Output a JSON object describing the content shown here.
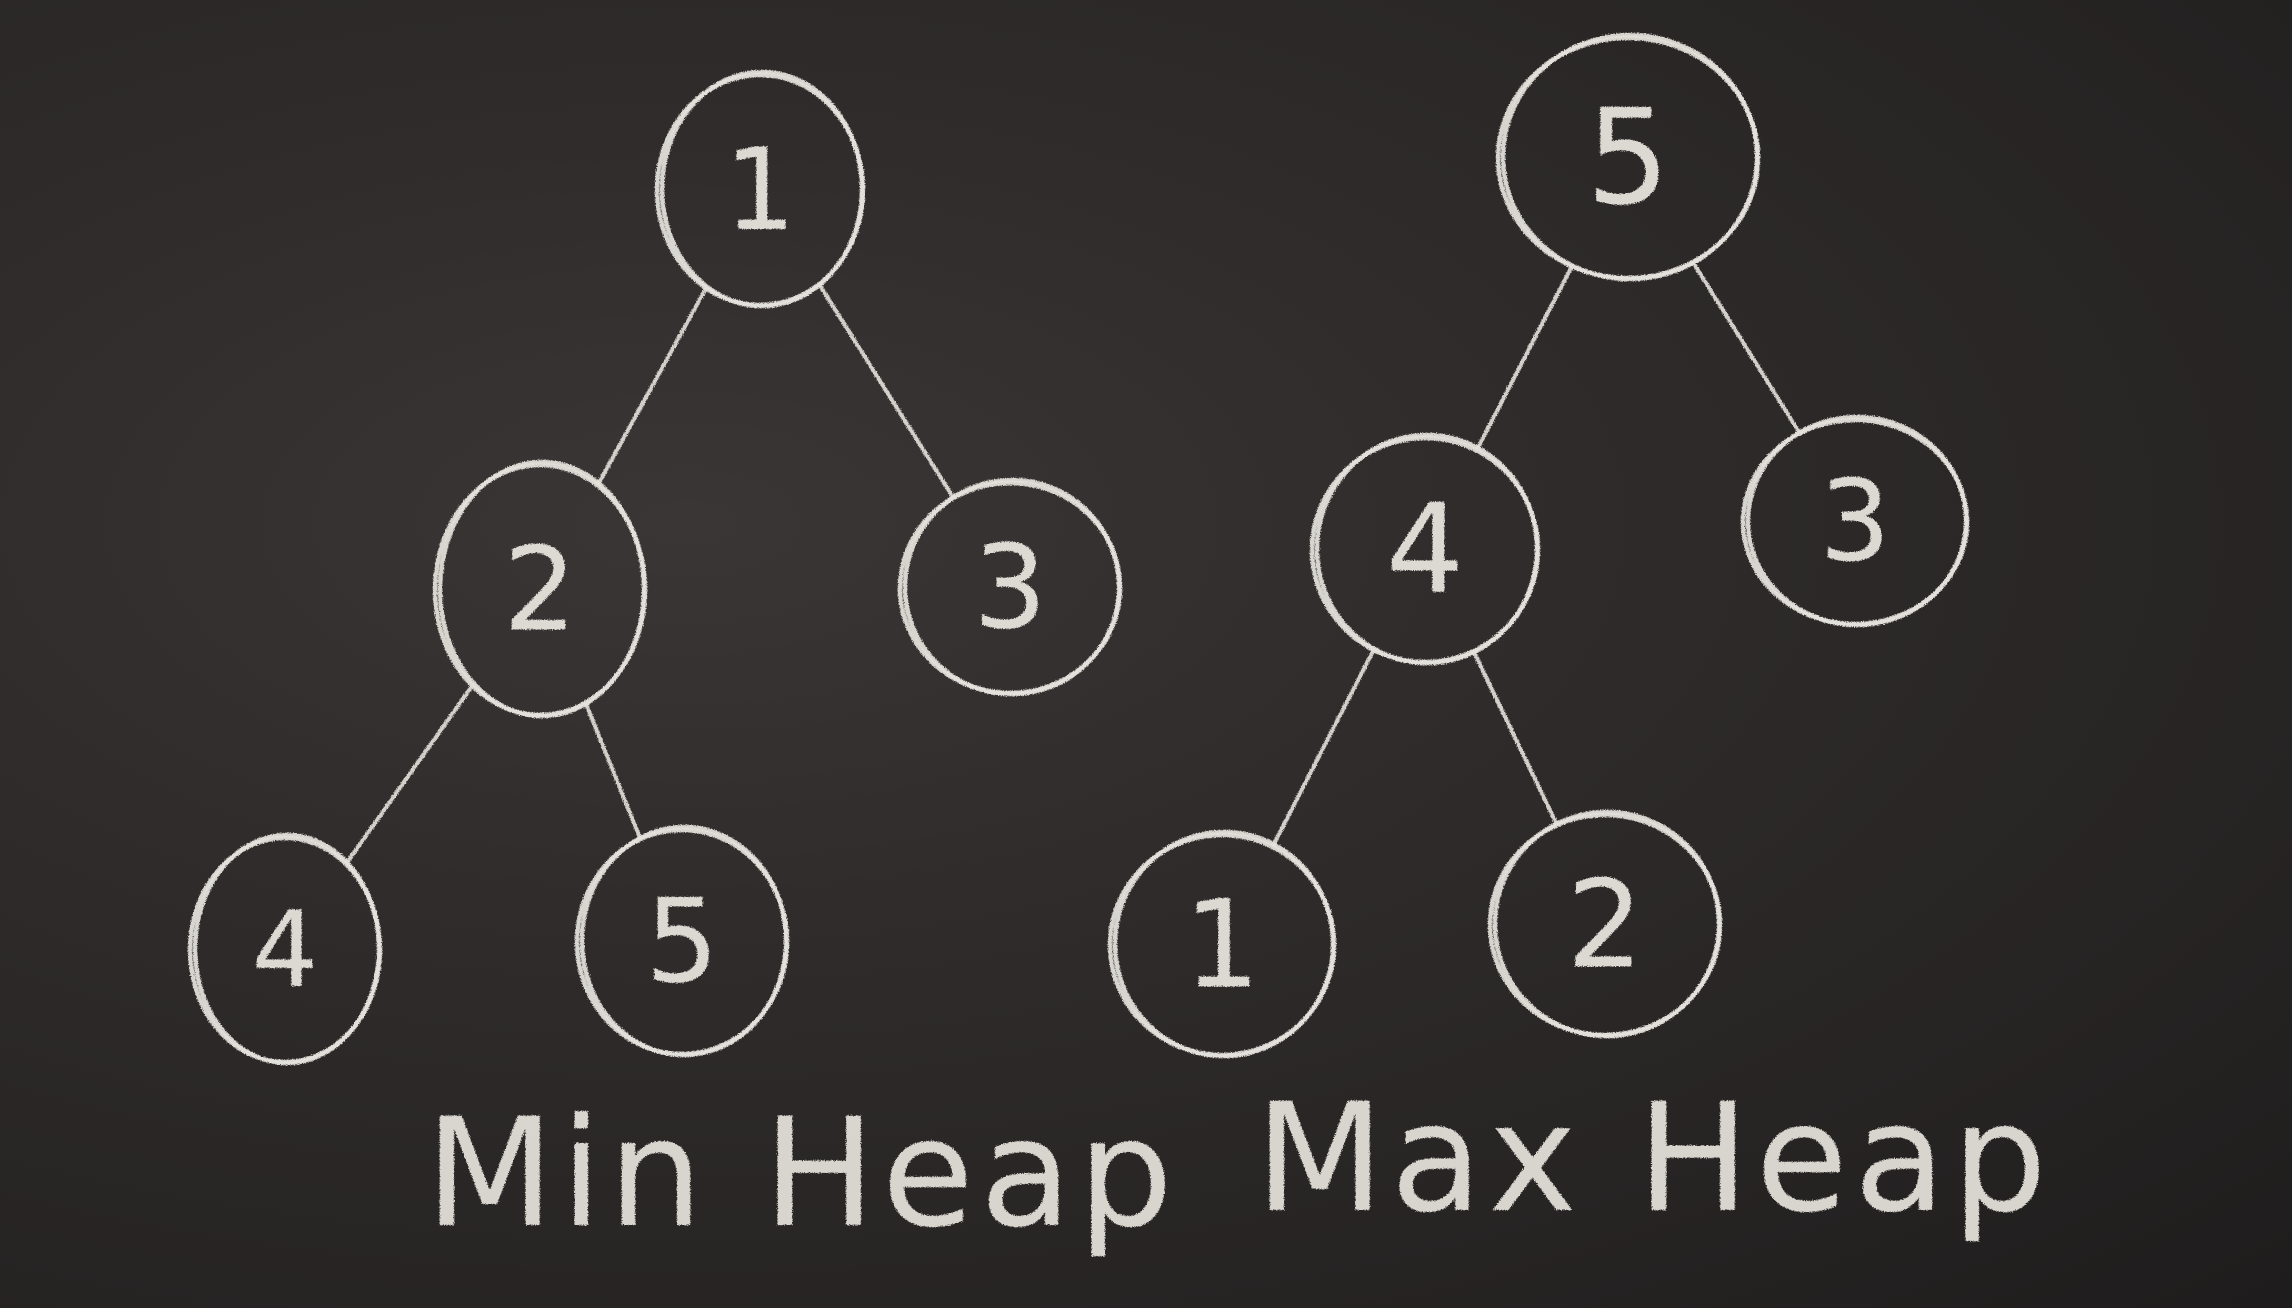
{
  "diagram": {
    "min_heap": {
      "caption": "Min Heap",
      "nodes": [
        {
          "id": "min-n1",
          "label": "1"
        },
        {
          "id": "min-n2",
          "label": "2"
        },
        {
          "id": "min-n3",
          "label": "3"
        },
        {
          "id": "min-n4",
          "label": "4"
        },
        {
          "id": "min-n5",
          "label": "5"
        }
      ],
      "edges": [
        [
          "min-n1",
          "min-n2"
        ],
        [
          "min-n1",
          "min-n3"
        ],
        [
          "min-n2",
          "min-n4"
        ],
        [
          "min-n2",
          "min-n5"
        ]
      ]
    },
    "max_heap": {
      "caption": "Max Heap",
      "nodes": [
        {
          "id": "max-n5",
          "label": "5"
        },
        {
          "id": "max-n4",
          "label": "4"
        },
        {
          "id": "max-n3",
          "label": "3"
        },
        {
          "id": "max-n1",
          "label": "1"
        },
        {
          "id": "max-n2",
          "label": "2"
        }
      ],
      "edges": [
        [
          "max-n5",
          "max-n4"
        ],
        [
          "max-n5",
          "max-n3"
        ],
        [
          "max-n4",
          "max-n1"
        ],
        [
          "max-n4",
          "max-n2"
        ]
      ]
    },
    "colors": {
      "board": "#2b2828",
      "chalk": "#e4e2dc"
    }
  }
}
